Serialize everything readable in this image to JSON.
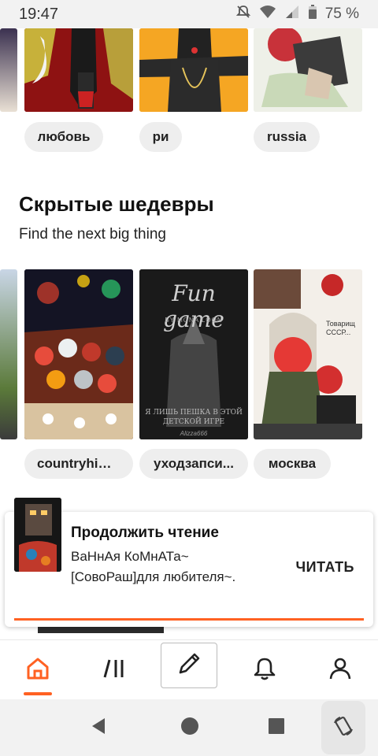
{
  "status_bar": {
    "time": "19:47",
    "battery": "75 %"
  },
  "row1": {
    "tags": [
      "любовь",
      "ри",
      "russia"
    ]
  },
  "section": {
    "title": "Скрытые шедевры",
    "subtitle": "Find the next big thing"
  },
  "row2": {
    "covers": [
      {
        "name": "countryhumans-cover",
        "text": ""
      },
      {
        "name": "fun-game-cover",
        "title": "Fun game",
        "author": "BY MONA LOON",
        "caption": "Я ЛИШЬ ПЕШКА В ЭТОЙ ДЕТСКОЙ ИГРЕ",
        "signature": "Alizza666"
      },
      {
        "name": "moscow-cover",
        "speech": "Товарищ СССР..."
      }
    ],
    "tags": [
      "countryhim...",
      "уходзапси...",
      "москва"
    ]
  },
  "continue_reading": {
    "title": "Продолжить чтение",
    "story": "ВаНнАя КоМнАТа~[СовоРаш]для любителя~.",
    "action": "ЧИТАТЬ",
    "progress": 1.0
  },
  "nav": {
    "items": [
      "home-icon",
      "library-icon",
      "write-icon",
      "notifications-icon",
      "profile-icon"
    ],
    "accent": "#ff6122"
  }
}
